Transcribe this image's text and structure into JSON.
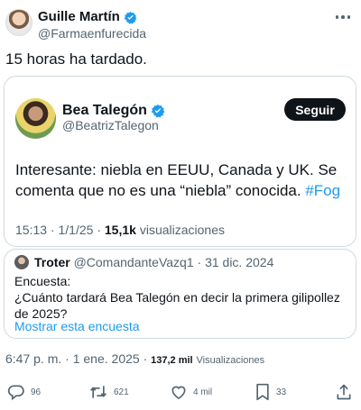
{
  "author": {
    "name": "Guille Martín",
    "handle": "@Farmaenfurecida"
  },
  "tweet_text": "15 horas ha tardado.",
  "quote1": {
    "name": "Bea Talegón",
    "handle": "@BeatrizTalegon",
    "follow_label": "Seguir",
    "text_main": "Interesante: niebla en EEUU, Canada y UK. Se comenta que no es una “niebla” conocida. ",
    "hashtag": "#Fog",
    "time": "15:13",
    "date": "1/1/25",
    "views_count": "15,1k",
    "views_label": "visualizaciones"
  },
  "quote2": {
    "name": "Troter",
    "handle": "@ComandanteVazq1",
    "date": "31 dic. 2024",
    "line1": "Encuesta:",
    "line2": "¿Cuánto tardará Bea Talegón en decir la primera gilipollez de 2025?",
    "poll_link": "Mostrar esta encuesta"
  },
  "meta": {
    "time": "6:47 p. m.",
    "date": "1 ene. 2025",
    "views_count": "137,2 mil",
    "views_label": "Visualizaciones"
  },
  "actions": {
    "replies": "96",
    "retweets": "621",
    "likes": "4 mil",
    "bookmarks": "33"
  },
  "icons": {
    "verified": "verified-badge-icon",
    "more": "more-options-icon",
    "reply": "reply-icon",
    "retweet": "retweet-icon",
    "like": "like-icon",
    "bookmark": "bookmark-icon",
    "share": "share-icon"
  },
  "colors": {
    "accent": "#1d9bf0",
    "text": "#0f1419",
    "muted": "#536471",
    "border": "#cfd9de"
  }
}
